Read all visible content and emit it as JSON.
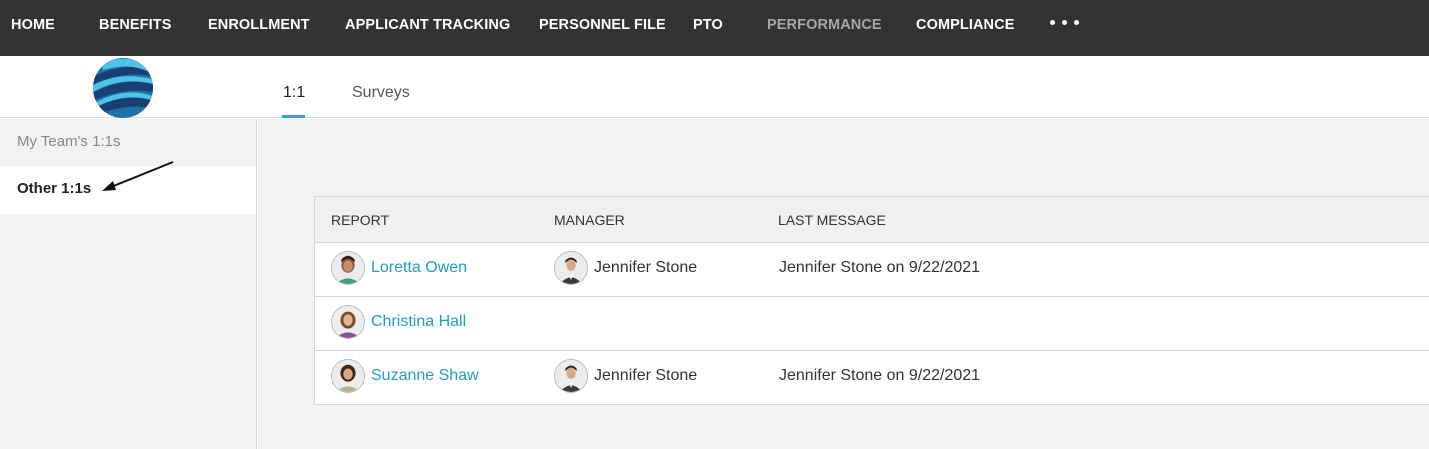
{
  "nav": {
    "items": [
      "HOME",
      "BENEFITS",
      "ENROLLMENT",
      "APPLICANT TRACKING",
      "PERSONNEL FILE",
      "PTO",
      "PERFORMANCE",
      "COMPLIANCE"
    ],
    "active": "PERFORMANCE",
    "more_icon": "ellipsis-icon"
  },
  "tabs": [
    "1:1",
    "Surveys"
  ],
  "active_tab": "1:1",
  "sidebar": {
    "items": [
      "My Team's 1:1s",
      "Other 1:1s"
    ],
    "active": "Other 1:1s"
  },
  "table": {
    "headers": [
      "REPORT",
      "MANAGER",
      "LAST MESSAGE"
    ],
    "rows": [
      {
        "report": "Loretta Owen",
        "manager": "Jennifer Stone",
        "last_message": "Jennifer Stone on 9/22/2021"
      },
      {
        "report": "Christina Hall",
        "manager": "",
        "last_message": ""
      },
      {
        "report": "Suzanne Shaw",
        "manager": "Jennifer Stone",
        "last_message": "Jennifer Stone on 9/22/2021"
      }
    ]
  },
  "colors": {
    "nav_bg": "#333333",
    "accent": "#2aa8c7",
    "link": "#1e9ec4"
  }
}
